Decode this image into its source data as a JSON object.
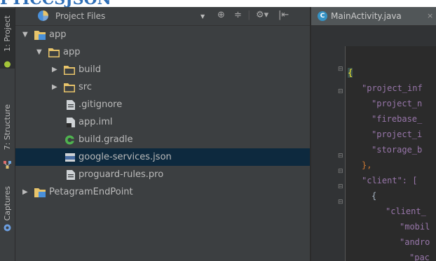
{
  "page_title_fragment": "FTICCSJSON",
  "tool_strip": {
    "tabs": [
      {
        "label": "1: Project",
        "active": true
      },
      {
        "label": "7: Structure",
        "active": false
      },
      {
        "label": "Captures",
        "active": false
      }
    ]
  },
  "project_panel": {
    "title": "Project Files",
    "tools": [
      "⊕",
      "≑",
      "|",
      "⚙▾",
      "|⇤"
    ],
    "tree": [
      {
        "label": "app",
        "depth": 0,
        "arrow": "▼",
        "icon": "module-folder-icon"
      },
      {
        "label": "app",
        "depth": 1,
        "arrow": "▼",
        "icon": "folder-icon"
      },
      {
        "label": "build",
        "depth": 2,
        "arrow": "▶",
        "icon": "folder-icon"
      },
      {
        "label": "src",
        "depth": 2,
        "arrow": "▶",
        "icon": "folder-icon"
      },
      {
        "label": ".gitignore",
        "depth": 2,
        "arrow": "",
        "icon": "text-file-icon"
      },
      {
        "label": "app.iml",
        "depth": 2,
        "arrow": "",
        "icon": "iml-file-icon"
      },
      {
        "label": "build.gradle",
        "depth": 2,
        "arrow": "",
        "icon": "gradle-file-icon"
      },
      {
        "label": "google-services.json",
        "depth": 2,
        "arrow": "",
        "icon": "json-file-icon",
        "selected": true
      },
      {
        "label": "proguard-rules.pro",
        "depth": 2,
        "arrow": "",
        "icon": "text-file-icon"
      },
      {
        "label": "PetagramEndPoint",
        "depth": 0,
        "arrow": "▶",
        "icon": "module-folder-icon"
      }
    ]
  },
  "editor": {
    "tab_label": "MainActivity.java",
    "tab_close": "×",
    "code_lines": [
      {
        "text": "{",
        "kind": "brace"
      },
      {
        "text": "\"project_inf",
        "kind": "key",
        "indent": 1
      },
      {
        "text": "\"project_n",
        "kind": "key",
        "indent": 2
      },
      {
        "text": "\"firebase_",
        "kind": "key",
        "indent": 2
      },
      {
        "text": "\"project_i",
        "kind": "key",
        "indent": 2
      },
      {
        "text": "\"storage_b",
        "kind": "key",
        "indent": 2
      },
      {
        "text": "},",
        "kind": "punc",
        "indent": 1
      },
      {
        "text": "\"client\": [",
        "kind": "key",
        "indent": 1
      },
      {
        "text": "{",
        "kind": "plain",
        "indent": 2
      },
      {
        "text": "\"client_",
        "kind": "key",
        "indent": 3
      },
      {
        "text": "\"mobil",
        "kind": "key",
        "indent": 4
      },
      {
        "text": "\"andro",
        "kind": "key",
        "indent": 4
      },
      {
        "text": "\"pac",
        "kind": "key",
        "indent": 5
      }
    ]
  },
  "colors": {
    "panel_bg": "#3c3f41",
    "editor_bg": "#2b2b2b",
    "selection": "#0d293e",
    "text": "#bbbbbb",
    "json_key": "#9876aa",
    "folder": "#e8c46a",
    "module_folder": "#4a90d9"
  }
}
